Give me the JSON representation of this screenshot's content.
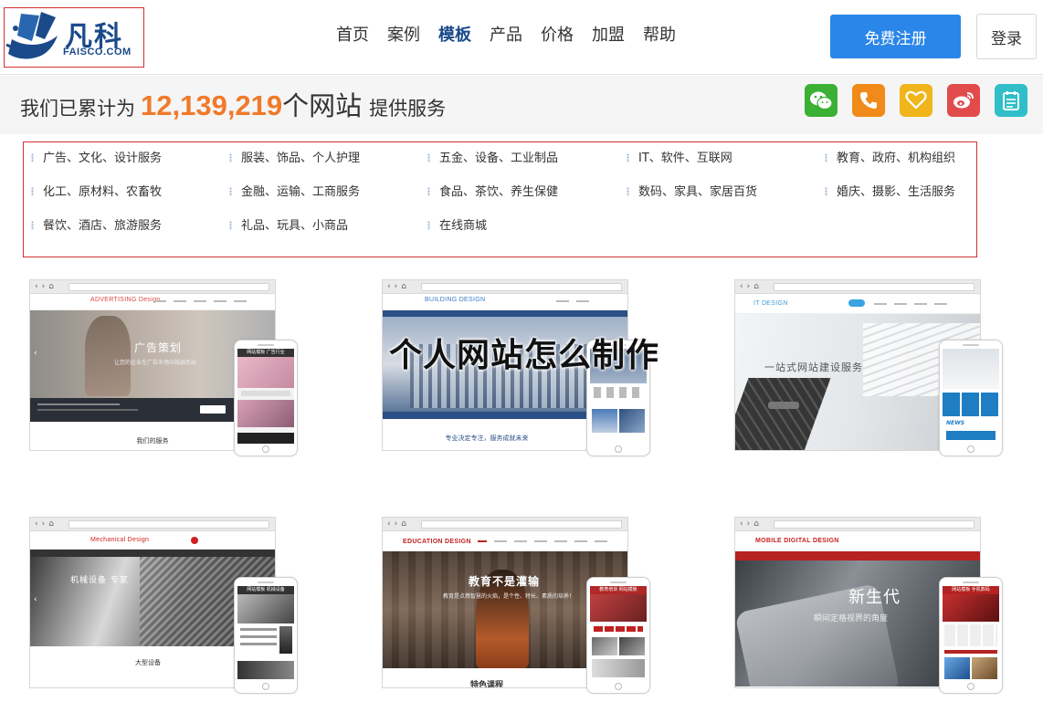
{
  "logo": {
    "cn": "凡科",
    "en": "FAISCO.COM"
  },
  "nav": [
    {
      "label": "首页",
      "active": false
    },
    {
      "label": "案例",
      "active": false
    },
    {
      "label": "模板",
      "active": true
    },
    {
      "label": "产品",
      "active": false
    },
    {
      "label": "价格",
      "active": false
    },
    {
      "label": "加盟",
      "active": false
    },
    {
      "label": "帮助",
      "active": false
    }
  ],
  "header": {
    "register_label": "免费注册",
    "login_label": "登录"
  },
  "stats": {
    "prefix": "我们已累计为",
    "number": "12,139,219",
    "unit": "个网站",
    "suffix": "提供服务"
  },
  "social_icons": [
    {
      "name": "wechat-icon",
      "color": "#3cb034"
    },
    {
      "name": "phone-icon",
      "color": "#f08a18"
    },
    {
      "name": "heart-icon",
      "color": "#f0b51a"
    },
    {
      "name": "weibo-icon",
      "color": "#e24b4b"
    },
    {
      "name": "notepad-icon",
      "color": "#30bfc8"
    }
  ],
  "categories": [
    "广告、文化、设计服务",
    "服装、饰品、个人护理",
    "五金、设备、工业制品",
    "IT、软件、互联网",
    "教育、政府、机构组织",
    "化工、原材料、农畜牧",
    "金融、运输、工商服务",
    "食品、茶饮、养生保健",
    "数码、家具、家居百货",
    "婚庆、摄影、生活服务",
    "餐饮、酒店、旅游服务",
    "礼品、玩具、小商品",
    "在线商城"
  ],
  "overlay_title": "个人网站怎么制作",
  "templates": [
    {
      "logo": "ADVERTISING Design",
      "logo_color": "#d44",
      "hero_title": "广告策划",
      "hero_sub": "让您的企业在广告市场中脱颖而出",
      "footer": "我们的服务",
      "phone_title": "网站模板 广告行业",
      "accent": "#2a2f38"
    },
    {
      "logo": "BUILDING DESIGN",
      "logo_color": "#3a7bc8",
      "hero_title": "",
      "hero_sub": "",
      "footer": "专业决定专注，服务成就未来",
      "phone_title": "",
      "accent": "#2c4f86"
    },
    {
      "logo": "IT DESIGN",
      "logo_color": "#3a9bd8",
      "hero_title": "一站式网站建设服务",
      "hero_sub": "",
      "footer": "",
      "phone_title": "",
      "accent": "#38a3e0"
    },
    {
      "logo": "Mechanical Design",
      "logo_color": "#d02020",
      "hero_title": "机械设备 专家",
      "hero_sub": "",
      "footer": "大型设备",
      "phone_title": "网站模板 机械设备",
      "accent": "#333"
    },
    {
      "logo": "EDUCATION DESIGN",
      "logo_color": "#c02020",
      "hero_title": "教育不是灌输",
      "hero_sub": "教育是点燃智慧的火焰，是个性、特长、素质的培养！",
      "footer": "特色课程",
      "phone_title": "教育培训 网站模板",
      "accent": "#b02828"
    },
    {
      "logo": "MOBILE DIGITAL DESIGN",
      "logo_color": "#c82020",
      "hero_title": "新生代",
      "hero_sub": "瞬间定格视界的角度",
      "footer": "",
      "phone_title": "网站模板 手机数码",
      "accent": "#b52222"
    }
  ]
}
